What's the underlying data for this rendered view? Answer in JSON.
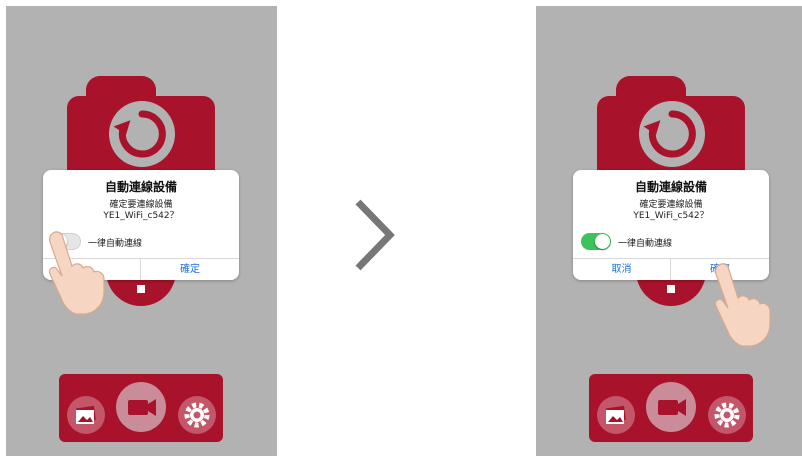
{
  "left_screen": {
    "dialog": {
      "title": "自動連線設備",
      "message_line1": "確定要連線設備",
      "message_line2": "YE1_WiFi_c542？",
      "toggle_label": "一律自動連線",
      "toggle_on": false,
      "confirm": "確定"
    }
  },
  "right_screen": {
    "dialog": {
      "title": "自動連線設備",
      "message_line1": "確定要連線設備",
      "message_line2": "YE1_WiFi_c542？",
      "toggle_label": "一律自動連線",
      "toggle_on": true,
      "cancel": "取消",
      "confirm": "確定"
    }
  },
  "icons": {
    "arrow": "chevron-right-icon",
    "camera": "camera-refresh-icon",
    "gallery": "gallery-icon",
    "video": "video-camera-icon",
    "settings": "gear-icon",
    "hand": "pointing-hand-icon"
  },
  "colors": {
    "brand_red": "#a8122a",
    "background_gray": "#b2b2b2",
    "toggle_on": "#3dc35b",
    "button_text": "#1a6fd6"
  }
}
